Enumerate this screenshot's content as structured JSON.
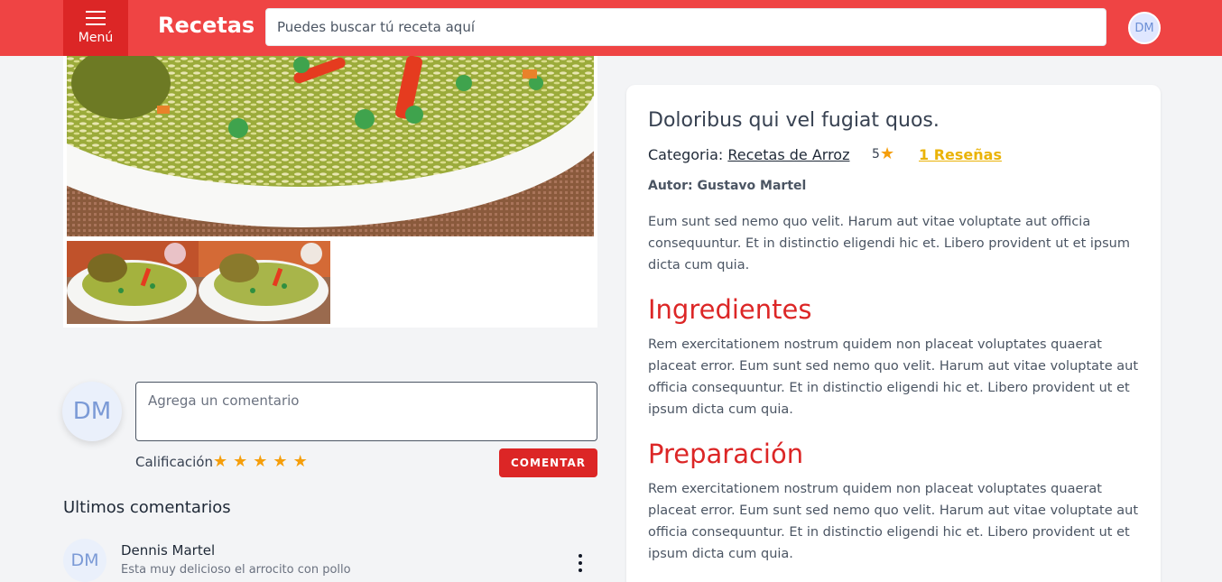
{
  "header": {
    "menu_label": "Menú",
    "brand": "Recetas",
    "search_placeholder": "Puedes buscar tú receta aquí",
    "user_initials": "DM"
  },
  "comment_form": {
    "user_initials": "DM",
    "placeholder": "Agrega un comentario",
    "rating_label": "Calificación",
    "rating_stars": 5,
    "submit_label": "COMENTAR"
  },
  "latest_comments": {
    "title": "Ultimos comentarios",
    "items": [
      {
        "initials": "DM",
        "name": "Dennis Martel",
        "text": "Esta muy delicioso el arrocito con pollo"
      }
    ]
  },
  "recipe": {
    "title": "Doloribus qui vel fugiat quos.",
    "category_label": "Categoria:",
    "category": "Recetas de Arroz",
    "rating": "5",
    "reviews": "1 Reseñas",
    "author": "Autor: Gustavo Martel",
    "description": "Eum sunt sed nemo quo velit. Harum aut vitae voluptate aut officia consequuntur. Et in distinctio eligendi hic et. Libero provident ut et ipsum dicta cum quia.",
    "ingredients_title": "Ingredientes",
    "ingredients_text": "Rem exercitationem nostrum quidem non placeat voluptates quaerat placeat error. Eum sunt sed nemo quo velit. Harum aut vitae voluptate aut officia consequuntur. Et in distinctio eligendi hic et. Libero provident ut et ipsum dicta cum quia.",
    "preparation_title": "Preparación",
    "preparation_text": "Rem exercitationem nostrum quidem non placeat voluptates quaerat placeat error. Eum sunt sed nemo quo velit. Harum aut vitae voluptate aut officia consequuntur. Et in distinctio eligendi hic et. Libero provident ut et ipsum dicta cum quia."
  },
  "colors": {
    "header": "#ef4444",
    "menu_button": "#dc2626",
    "accent_red": "#dc2626",
    "star": "#f59e0b",
    "reviews_link": "#eab308"
  }
}
